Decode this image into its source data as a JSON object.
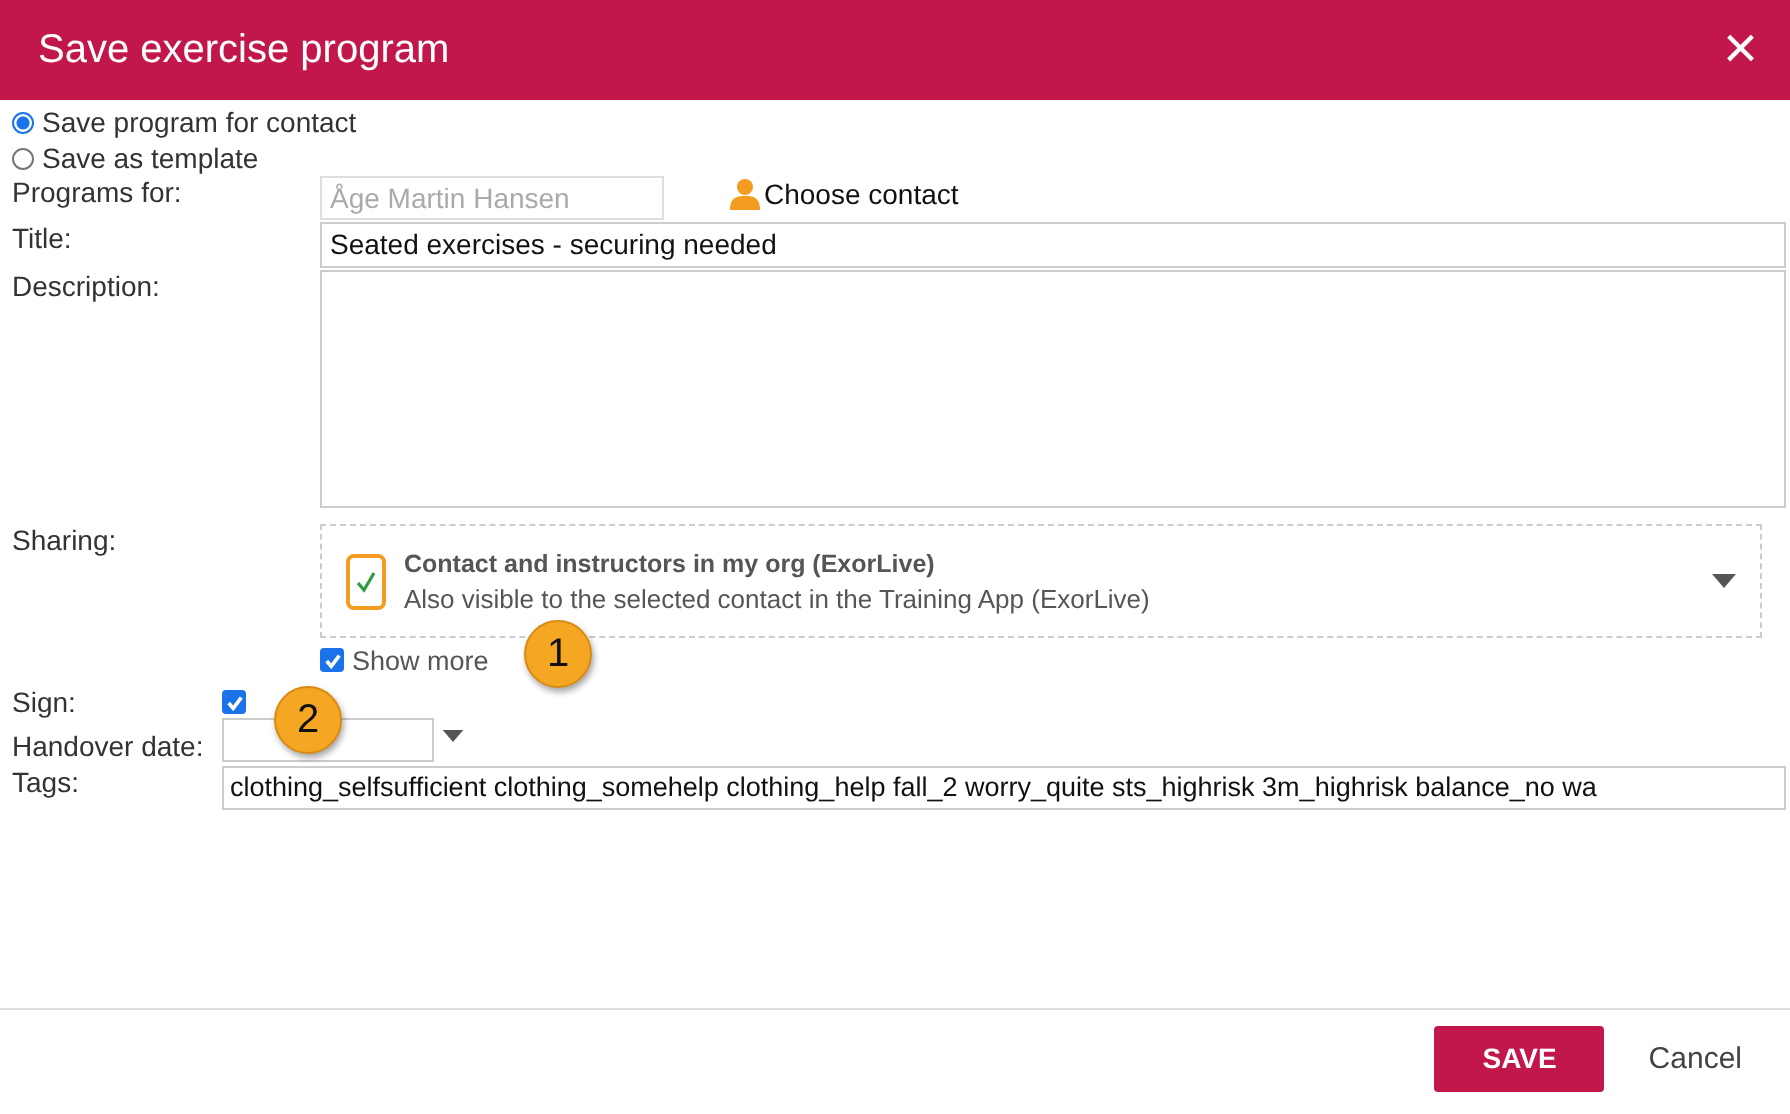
{
  "window": {
    "title": "Save exercise program",
    "close": "×"
  },
  "save_mode": [
    {
      "label": "Save program for contact",
      "selected": true
    },
    {
      "label": "Save as template",
      "selected": false
    }
  ],
  "programs_for": {
    "label": "Programs for:",
    "value": "Åge Martin Hansen",
    "choose_contact": "Choose contact"
  },
  "title_field": {
    "label": "Title:",
    "value": "Seated exercises - securing needed"
  },
  "description": {
    "label": "Description:"
  },
  "sharing": {
    "label": "Sharing:",
    "checked": true,
    "title": "Contact and instructors in my org (ExorLive)",
    "subtitle": "Also visible to the selected contact in the Training App (ExorLive)"
  },
  "show_more": {
    "label": "Show more",
    "checked": true
  },
  "sign": {
    "label": "Sign:",
    "checked": true
  },
  "handover_date": {
    "label": "Handover date:"
  },
  "tags": {
    "label": "Tags:",
    "value": "clothing_selfsufficient clothing_somehelp clothing_help fall_2 worry_quite sts_highrisk 3m_highrisk balance_no wa"
  },
  "callouts": [
    "1",
    "2"
  ],
  "buttons": {
    "save": "SAVE",
    "cancel": "Cancel"
  }
}
